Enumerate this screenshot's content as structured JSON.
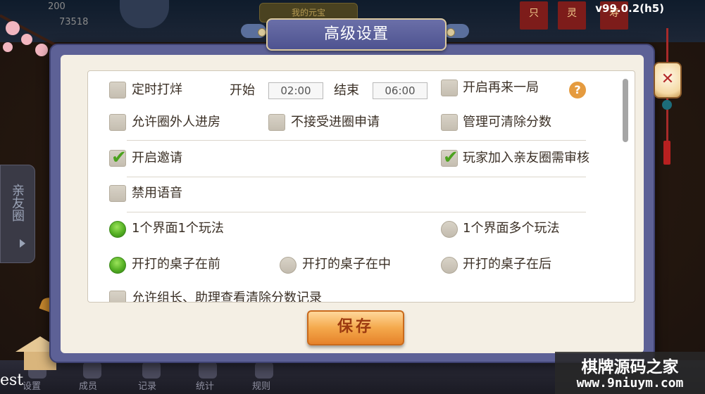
{
  "header": {
    "score_top": "200",
    "score_bottom": "73518",
    "my_coins_label": "我的元宝",
    "version": "v99.0.2(h5)",
    "banners": [
      "只",
      "灵",
      "寿"
    ]
  },
  "side_tab": {
    "label": "亲友圈"
  },
  "corner_text": "est",
  "bottom_nav": [
    "设置",
    "成员",
    "记录",
    "统计",
    "规则"
  ],
  "dialog": {
    "title": "高级设置",
    "close_icon": "close-x-icon",
    "rows": {
      "timed_close": {
        "label": "定时打烊",
        "checked": false
      },
      "start_label": "开始",
      "start_time": "02:00",
      "end_label": "结束",
      "end_time": "06:00",
      "rematch": {
        "label": "开启再来一局",
        "checked": false
      },
      "help_icon": "?",
      "allow_outsiders": {
        "label": "允许圈外人进房",
        "checked": false
      },
      "reject_join_requests": {
        "label": "不接受进圈申请",
        "checked": false
      },
      "manager_clear_score": {
        "label": "管理可清除分数",
        "checked": false
      },
      "enable_invite": {
        "label": "开启邀请",
        "checked": true
      },
      "join_needs_review": {
        "label": "玩家加入亲友圈需审核",
        "checked": true
      },
      "disable_voice": {
        "label": "禁用语音",
        "checked": false
      },
      "one_screen_one_mode": {
        "label": "1个界面1个玩法",
        "selected": true
      },
      "one_screen_multi_mode": {
        "label": "1个界面多个玩法",
        "selected": false
      },
      "tables_front": {
        "label": "开打的桌子在前",
        "selected": true
      },
      "tables_middle": {
        "label": "开打的桌子在中",
        "selected": false
      },
      "tables_back": {
        "label": "开打的桌子在后",
        "selected": false
      },
      "allow_leader_view": {
        "label": "允许组长、助理查看清除分数记录",
        "checked": false
      }
    },
    "save_label": "保存"
  },
  "watermark": {
    "title": "棋牌源码之家",
    "url": "www.9niuym.com"
  },
  "colors": {
    "dialog_frame": "#5d6196",
    "panel_bg": "#f4efe4",
    "check_green": "#4ca21e",
    "save_orange": "#f4a94c"
  }
}
